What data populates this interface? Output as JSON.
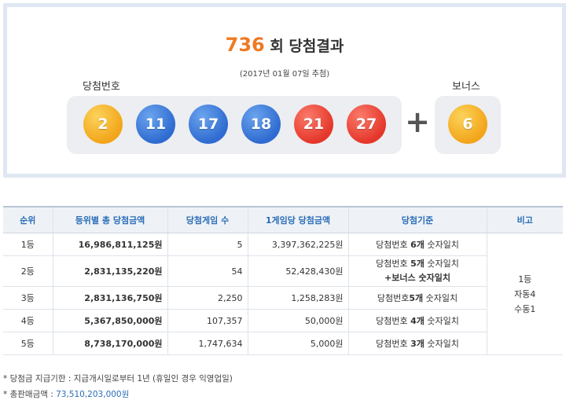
{
  "header": {
    "round": "736",
    "title_suffix": " 회 당첨결과",
    "draw_date": "(2017년 01월 07일 추첨)",
    "main_label": "당첨번호",
    "bonus_label": "보너스"
  },
  "numbers": [
    {
      "value": "2",
      "color": "#f2a51a"
    },
    {
      "value": "11",
      "color": "#2f6bd0"
    },
    {
      "value": "17",
      "color": "#2f6bd0"
    },
    {
      "value": "18",
      "color": "#2f6bd0"
    },
    {
      "value": "21",
      "color": "#e4372a"
    },
    {
      "value": "27",
      "color": "#e4372a"
    }
  ],
  "plus_sign": "+",
  "bonus": {
    "value": "6",
    "color": "#f2a51a"
  },
  "table": {
    "headers": [
      "순위",
      "등위별 총 당첨금액",
      "당첨게임 수",
      "1게임당 당첨금액",
      "당첨기준",
      "비고"
    ],
    "rows": [
      {
        "rank": "1등",
        "total": "16,986,811,125원",
        "games": "5",
        "per_game": "3,397,362,225원",
        "criteria_pre": "당첨번호 ",
        "criteria_bold": "6개",
        "criteria_post": " 숫자일치",
        "criteria_line2": ""
      },
      {
        "rank": "2등",
        "total": "2,831,135,220원",
        "games": "54",
        "per_game": "52,428,430원",
        "criteria_pre": "당첨번호 ",
        "criteria_bold": "5개",
        "criteria_post": " 숫자일치",
        "criteria_line2": "+보너스 숫자일치"
      },
      {
        "rank": "3등",
        "total": "2,831,136,750원",
        "games": "2,250",
        "per_game": "1,258,283원",
        "criteria_pre": "당첨번호",
        "criteria_bold": "5개",
        "criteria_post": " 숫자일치",
        "criteria_line2": ""
      },
      {
        "rank": "4등",
        "total": "5,367,850,000원",
        "games": "107,357",
        "per_game": "50,000원",
        "criteria_pre": "당첨번호 ",
        "criteria_bold": "4개",
        "criteria_post": " 숫자일치",
        "criteria_line2": ""
      },
      {
        "rank": "5등",
        "total": "8,738,170,000원",
        "games": "1,747,634",
        "per_game": "5,000원",
        "criteria_pre": "당첨번호 ",
        "criteria_bold": "3개",
        "criteria_post": " 숫자일치",
        "criteria_line2": ""
      }
    ],
    "remark": [
      "1등",
      "자동4",
      "수동1"
    ]
  },
  "footnotes": {
    "payout_period": "* 당첨금 지급기한 : 지급개시일로부터 1년 (휴일인 경우 익영업일)",
    "total_sales_label": "* 총판매금액 : ",
    "total_sales_value": "73,510,203,000원"
  }
}
